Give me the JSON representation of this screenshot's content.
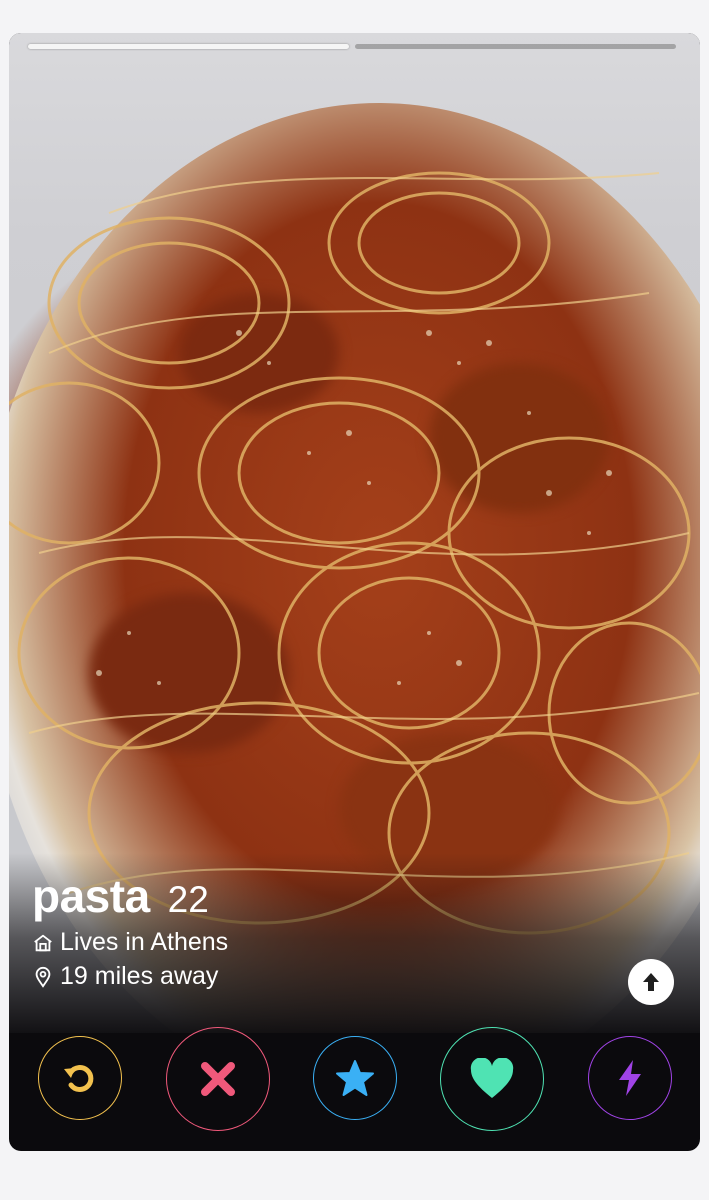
{
  "profile": {
    "name": "pasta",
    "age": "22",
    "lives_in": "Lives in Athens",
    "distance": "19 miles away"
  },
  "photo_progress": {
    "count": 2,
    "active_index": 0
  },
  "actions": [
    {
      "name": "rewind",
      "icon": "rewind-icon",
      "color": "#f2c14e"
    },
    {
      "name": "nope",
      "icon": "x-icon",
      "color": "#f0597b"
    },
    {
      "name": "super-like",
      "icon": "star-icon",
      "color": "#3ab0f5"
    },
    {
      "name": "like",
      "icon": "heart-icon",
      "color": "#4fe3b3"
    },
    {
      "name": "boost",
      "icon": "lightning-icon",
      "color": "#a043e6"
    }
  ],
  "icons": {
    "home": "home-icon",
    "location": "location-pin-icon",
    "info": "up-arrow-icon"
  }
}
